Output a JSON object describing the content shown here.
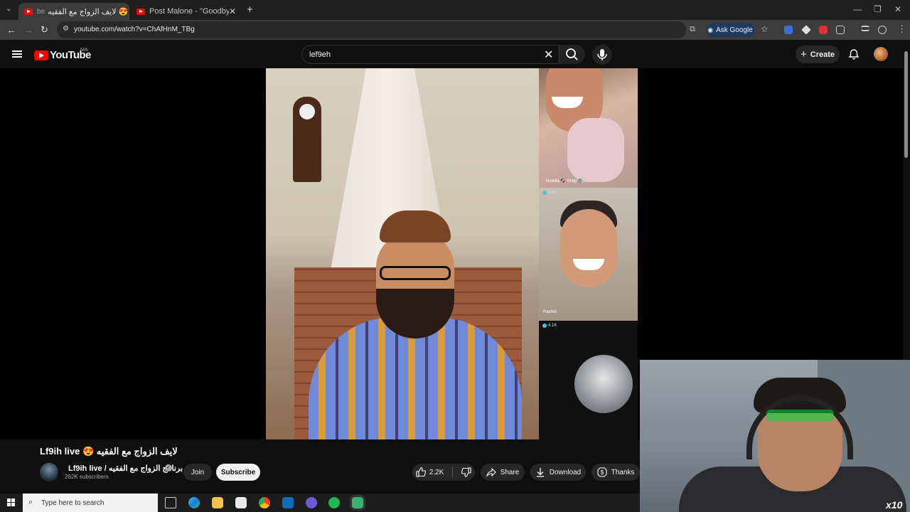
{
  "browser": {
    "tabs": [
      {
        "label": "لايف الزواج مع الفقيه 😍",
        "label_prefix": "be",
        "active": true
      },
      {
        "label": "Post Malone - \"Goodbyes\" ft. Y",
        "active": false
      }
    ],
    "new_tab": "+",
    "url": "youtube.com/watch?v=ChAfHnM_TBg",
    "ask_google": "Ask Google"
  },
  "youtube": {
    "logo_text": "YouTube",
    "country_code": "MA",
    "search_value": "lef9eh",
    "create_label": "Create"
  },
  "video": {
    "side_tiles": [
      {
        "caption": "Nutella 🍫 Shop 🛍️"
      },
      {
        "viewers": "3.4K",
        "caption": "Rachid"
      },
      {
        "viewers": "4.1K"
      }
    ],
    "overlay_text": "x10"
  },
  "watch": {
    "title": "Lf9ih live 😍 لايف الزواج مع الفقيه",
    "channel_name": "Lf9ih live / برنامج الزواج مع الفقيه",
    "subscribers": "262K subscribers",
    "join_label": "Join",
    "subscribe_label": "Subscribe",
    "likes": "2.2K",
    "share_label": "Share",
    "download_label": "Download",
    "thanks_label": "Thanks"
  },
  "taskbar": {
    "search_placeholder": "Type here to search"
  },
  "colors": {
    "accent_red": "#ff0000",
    "background": "#0f0f0f",
    "pill": "#272727"
  }
}
